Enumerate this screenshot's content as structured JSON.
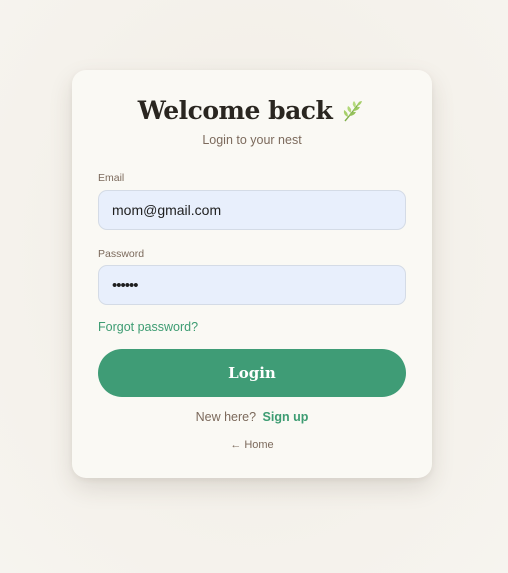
{
  "login": {
    "title": "Welcome back",
    "title_icon": "leaf-icon",
    "subtitle": "Login to your nest",
    "email": {
      "label": "Email",
      "value": "mom@gmail.com"
    },
    "password": {
      "label": "Password",
      "value": "••••••"
    },
    "forgot_label": "Forgot password?",
    "login_label": "Login",
    "signup_prompt": "New here?",
    "signup_label": "Sign up",
    "home_arrow": "←",
    "home_label": "Home"
  },
  "colors": {
    "accent": "#3f9c76",
    "card": "#faf9f4",
    "input_bg": "#e8effc",
    "page_bg": "#f4f1ea"
  }
}
